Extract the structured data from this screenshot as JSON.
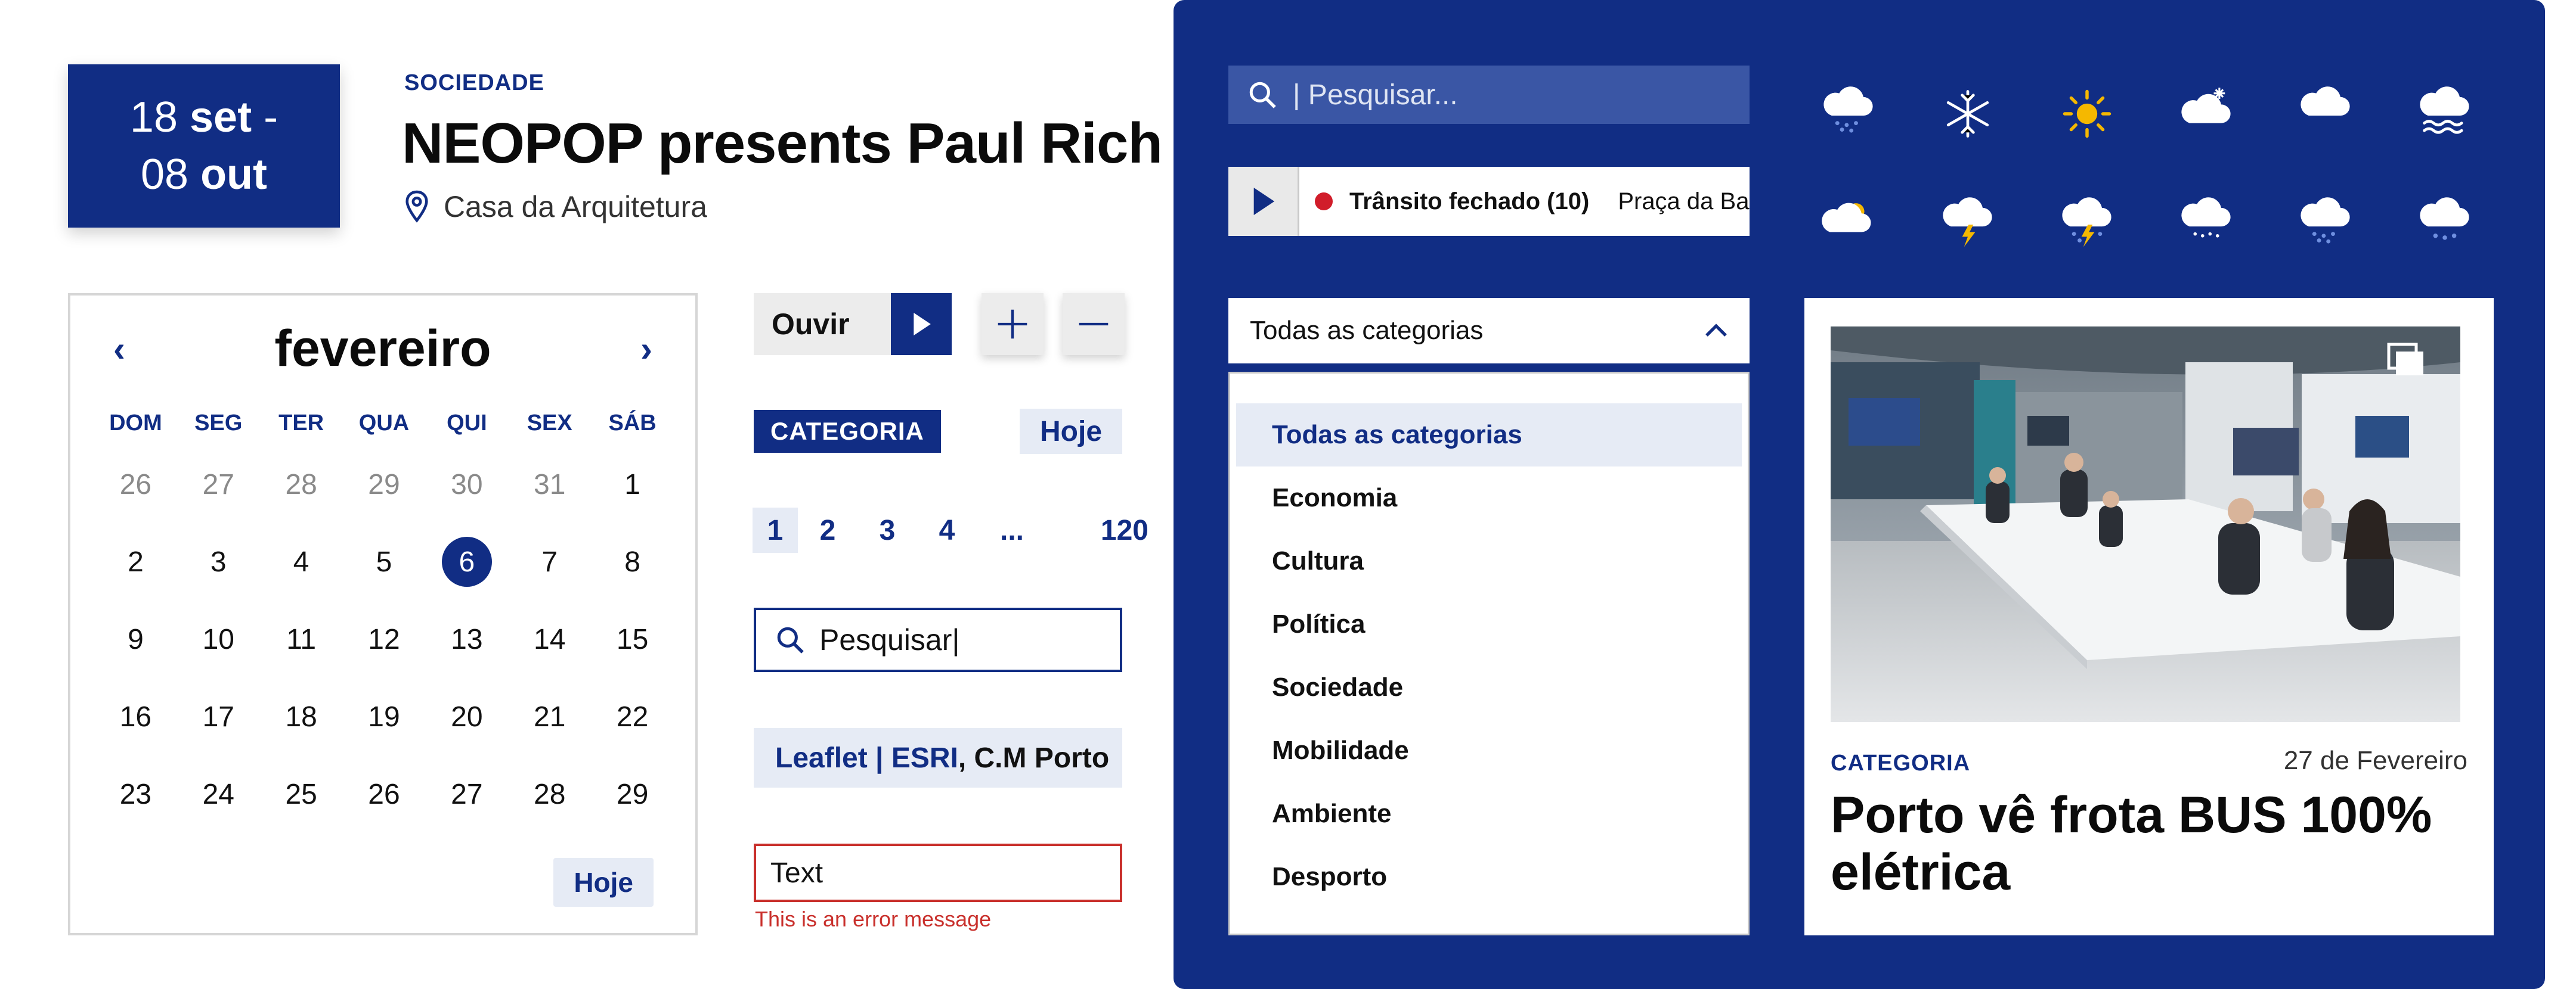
{
  "event": {
    "date_from_day": "18",
    "date_from_month": "set",
    "date_sep": "-",
    "date_to_day": "08",
    "date_to_month": "out",
    "category": "SOCIEDADE",
    "title": "NEOPOP presents Paul Rich",
    "location": "Casa da Arquitetura"
  },
  "calendar": {
    "month": "fevereiro",
    "weekdays": [
      "DOM",
      "SEG",
      "TER",
      "QUA",
      "QUI",
      "SEX",
      "SÁB"
    ],
    "weeks": [
      [
        "26",
        "27",
        "28",
        "29",
        "30",
        "31",
        "1"
      ],
      [
        "2",
        "3",
        "4",
        "5",
        "6",
        "7",
        "8"
      ],
      [
        "9",
        "10",
        "11",
        "12",
        "13",
        "14",
        "15"
      ],
      [
        "16",
        "17",
        "18",
        "19",
        "20",
        "21",
        "22"
      ],
      [
        "23",
        "24",
        "25",
        "26",
        "27",
        "28",
        "29"
      ]
    ],
    "selected_day": "6",
    "today_label": "Hoje"
  },
  "controls": {
    "listen_label": "Ouvir",
    "plus_symbol": "+",
    "minus_symbol": "—",
    "category_badge": "CATEGORIA",
    "today_label": "Hoje",
    "pagination": [
      "1",
      "2",
      "3",
      "4",
      "...",
      "120"
    ],
    "current_page": "1",
    "search_value": "Pesquisar|",
    "attribution_link": "Leaflet | ESRI",
    "attribution_rest": ", C.M Porto",
    "text_field_value": "Text",
    "error_message": "This is an error message"
  },
  "panel": {
    "search_placeholder": "| Pesquisar...",
    "ticker_title": "Trânsito fechado (10)",
    "ticker_place": "Praça da Batal",
    "weather_icons": [
      "cloud-rain-light-icon",
      "snowflake-icon",
      "sun-icon",
      "cloud-snow-icon",
      "cloud-icon",
      "cloud-fog-icon",
      "partly-cloudy-icon",
      "cloud-thunder-icon",
      "cloud-rain-thunder-icon",
      "cloud-drizzle-icon",
      "cloud-rain-heavy-icon",
      "cloud-rain-icon"
    ],
    "dropdown_value": "Todas as categorias",
    "dropdown_options": [
      "Todas as categorias",
      "Economia",
      "Cultura",
      "Política",
      "Sociedade",
      "Mobilidade",
      "Ambiente",
      "Desporto"
    ],
    "news": {
      "category": "CATEGORIA",
      "date": "27 de Fevereiro",
      "title": "Porto vê frota BUS 100% elétrica"
    }
  },
  "colors": {
    "brand": "#112d84",
    "error": "#c9302c",
    "ticker_dot": "#d11d2a",
    "sun": "#f5b800"
  }
}
